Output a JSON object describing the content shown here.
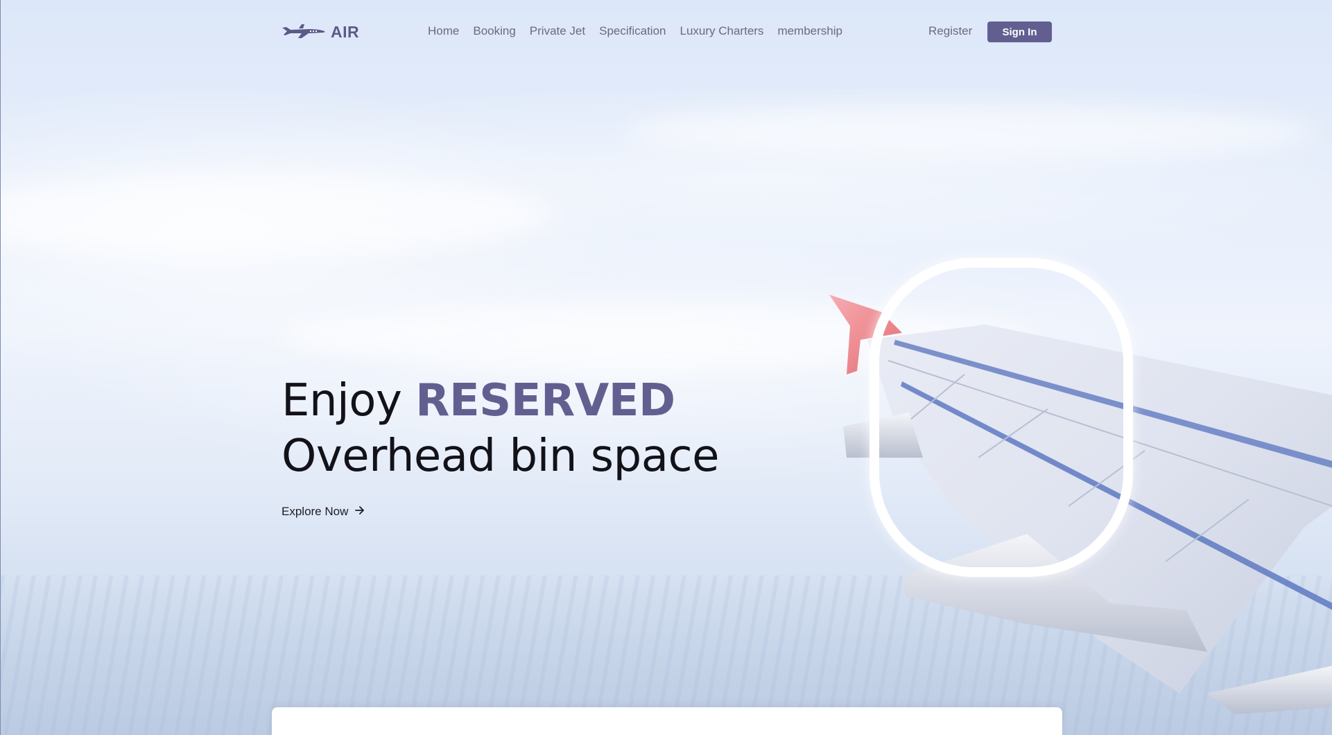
{
  "brand": {
    "name": "AIR",
    "logo_icon": "airplane-icon",
    "color": "#5b5a86"
  },
  "nav": {
    "links": [
      {
        "label": "Home"
      },
      {
        "label": "Booking"
      },
      {
        "label": "Private Jet"
      },
      {
        "label": "Specification"
      },
      {
        "label": "Luxury Charters"
      },
      {
        "label": "membership"
      }
    ],
    "register_label": "Register",
    "signin_label": "Sign In"
  },
  "hero": {
    "title_prefix": "Enjoy ",
    "title_accent": "RESERVED",
    "title_line2": "Overhead bin space",
    "cta_label": "Explore Now",
    "cta_icon": "arrow-right-icon"
  },
  "theme": {
    "accent": "#625f90",
    "text_dark": "#121218",
    "nav_text": "#6b6b78"
  }
}
